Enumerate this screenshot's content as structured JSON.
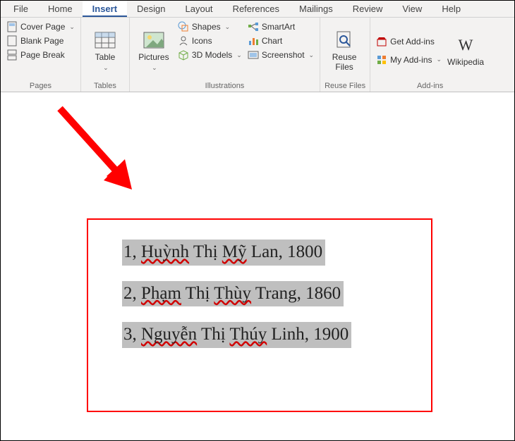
{
  "tabs": {
    "file": "File",
    "home": "Home",
    "insert": "Insert",
    "design": "Design",
    "layout": "Layout",
    "references": "References",
    "mailings": "Mailings",
    "review": "Review",
    "view": "View",
    "help": "Help"
  },
  "active_tab": "insert",
  "groups": {
    "pages": {
      "label": "Pages",
      "cover_page": "Cover Page",
      "blank_page": "Blank Page",
      "page_break": "Page Break"
    },
    "tables": {
      "label": "Tables",
      "table": "Table"
    },
    "illustrations": {
      "label": "Illustrations",
      "pictures": "Pictures",
      "shapes": "Shapes",
      "icons": "Icons",
      "models": "3D Models",
      "smartart": "SmartArt",
      "chart": "Chart",
      "screenshot": "Screenshot"
    },
    "reuse": {
      "label": "Reuse Files",
      "reuse": "Reuse\nFiles"
    },
    "addins": {
      "label": "Add-ins",
      "get": "Get Add-ins",
      "my": "My Add-ins",
      "wikipedia": "Wikipedia"
    }
  },
  "document": {
    "lines": [
      {
        "num": "1",
        "name_parts": [
          "Huỳnh",
          " Thị ",
          "Mỹ",
          " Lan"
        ],
        "val": "1800"
      },
      {
        "num": "2",
        "name_parts": [
          "Phạm",
          " Thị ",
          "Thùy",
          " Trang"
        ],
        "val": "1860"
      },
      {
        "num": "3",
        "name_parts": [
          "Nguyễn",
          " Thị ",
          "Thúy",
          " Linh"
        ],
        "val": "1900"
      }
    ]
  }
}
